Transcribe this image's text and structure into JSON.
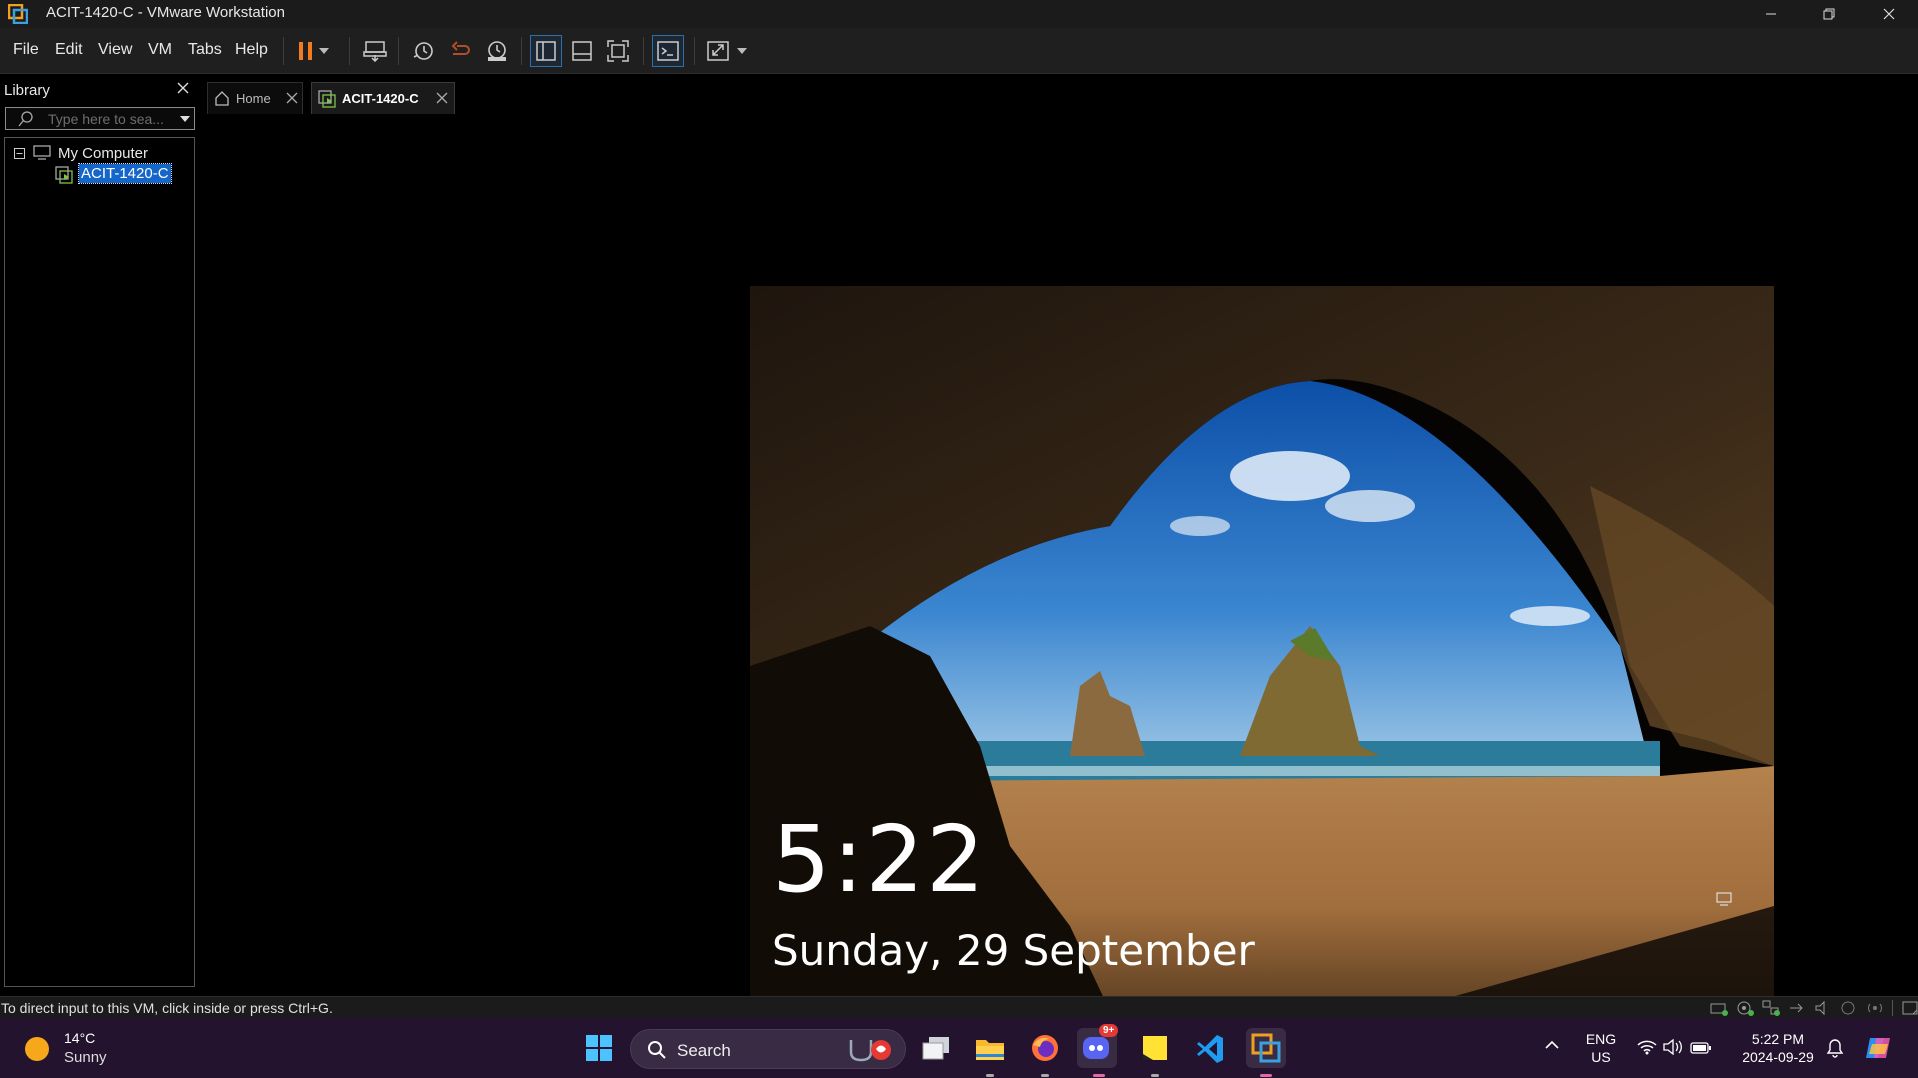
{
  "window": {
    "title": "ACIT-1420-C - VMware Workstation"
  },
  "menu": [
    "File",
    "Edit",
    "View",
    "VM",
    "Tabs",
    "Help"
  ],
  "menu_underline": [
    "F",
    "E",
    "V",
    "V",
    "T",
    "H"
  ],
  "toolbar_icons": [
    "pause-icon",
    "dropdown-icon",
    "send-ctrl-alt-del-icon",
    "snapshot-icon",
    "revert-snapshot-icon",
    "snapshot-manager-icon",
    "library-view-icon",
    "thumbnail-view-icon",
    "fullscreen-icon",
    "console-icon",
    "stretch-icon"
  ],
  "library": {
    "header": "Library",
    "search_placeholder": "Type here to sea...",
    "tree": {
      "root": "My Computer",
      "vm": "ACIT-1420-C"
    }
  },
  "tabs": [
    {
      "label": "Home",
      "icon": "home-icon",
      "selected": false
    },
    {
      "label": "ACIT-1420-C",
      "icon": "vm-icon",
      "selected": true
    }
  ],
  "lockscreen": {
    "time": "5:22",
    "date": "Sunday, 29 September"
  },
  "status": {
    "message": "To direct input to this VM, click inside or press Ctrl+G."
  },
  "taskbar": {
    "weather": {
      "temp": "14°C",
      "condition": "Sunny"
    },
    "search_label": "Search",
    "apps": [
      "start-icon",
      "task-view-icon",
      "file-explorer-icon",
      "firefox-icon",
      "discord-icon",
      "sticky-notes-icon",
      "vscode-icon",
      "vmware-icon"
    ],
    "discord_badge": "9+",
    "language": {
      "line1": "ENG",
      "line2": "US"
    },
    "clock": {
      "time": "5:22 PM",
      "date": "2024-09-29"
    }
  },
  "colors": {
    "accent": "#1566c9",
    "taskbar": "#23132e",
    "pause": "#f07b20"
  }
}
